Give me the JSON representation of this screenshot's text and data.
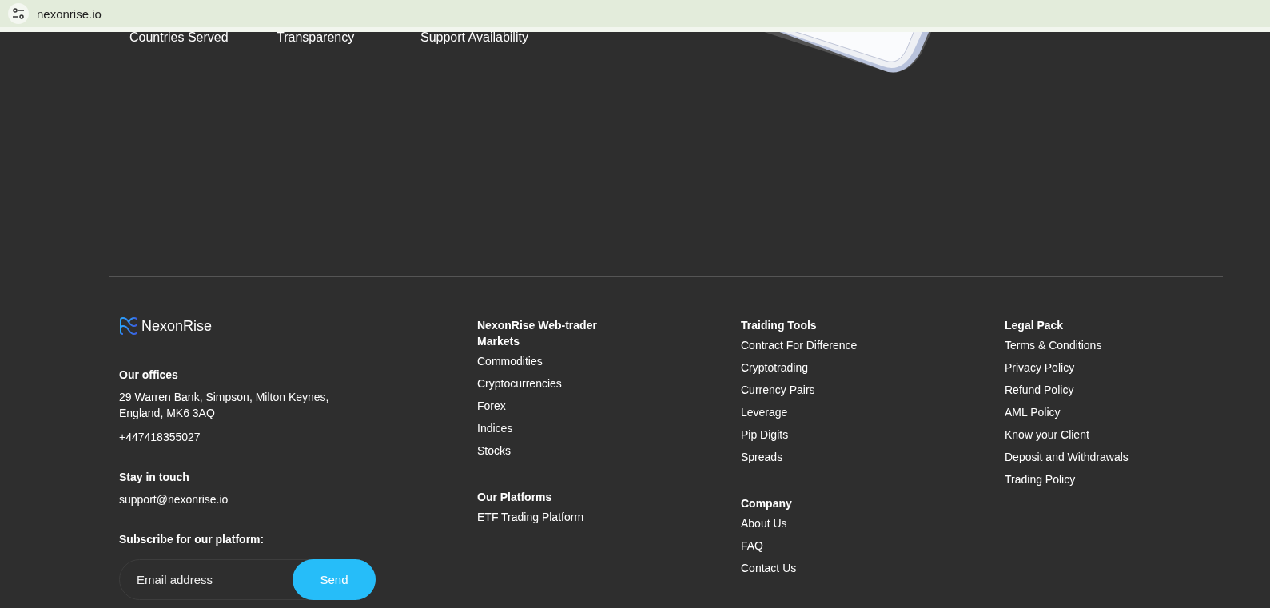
{
  "browser": {
    "url": "nexonrise.io"
  },
  "stats": [
    {
      "label": "Countries Served"
    },
    {
      "label": "Transparency"
    },
    {
      "label": "Support Availability"
    }
  ],
  "footer": {
    "brand": "NexonRise",
    "offices": {
      "heading": "Our offices",
      "address": "29 Warren Bank, Simpson, Milton Keynes, England, MK6 3AQ",
      "phone": "+447418355027"
    },
    "contact": {
      "heading": "Stay in touch",
      "email": "support@nexonrise.io"
    },
    "subscribe": {
      "heading": "Subscribe for our platform:",
      "placeholder": "Email address",
      "button": "Send"
    },
    "columns": [
      [
        {
          "heading": "NexonRise Web-trader Markets",
          "links": [
            "Commodities",
            "Cryptocurrencies",
            "Forex",
            "Indices",
            "Stocks"
          ]
        },
        {
          "heading": "Our Platforms",
          "links": [
            "ETF Trading Platform"
          ]
        }
      ],
      [
        {
          "heading": "Traiding Tools",
          "links": [
            "Contract For Difference",
            "Cryptotrading",
            "Currency Pairs",
            "Leverage",
            "Pip Digits",
            "Spreads"
          ]
        },
        {
          "heading": "Company",
          "links": [
            "About Us",
            "FAQ",
            "Contact Us"
          ]
        }
      ],
      [
        {
          "heading": "Legal Pack",
          "links": [
            "Terms & Conditions",
            "Privacy Policy",
            "Refund Policy",
            "AML Policy",
            "Know your Client",
            "Deposit and Withdrawals",
            "Trading Policy"
          ]
        }
      ]
    ]
  }
}
